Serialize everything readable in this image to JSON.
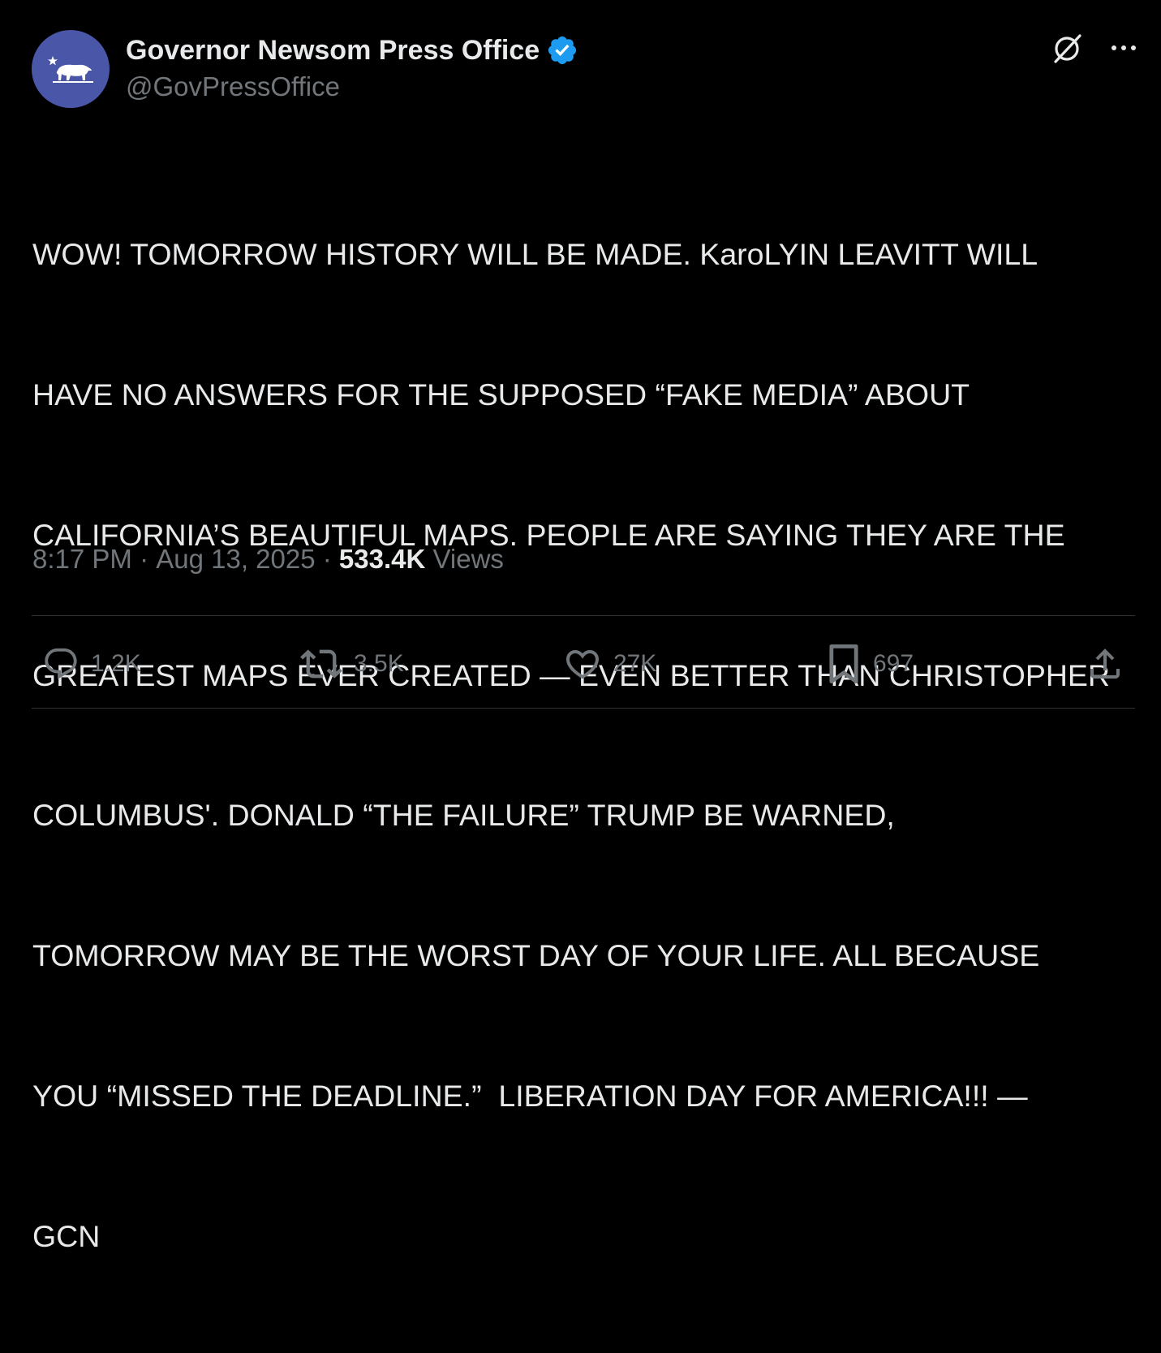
{
  "author": {
    "name": "Governor Newsom Press Office",
    "handle": "@GovPressOffice",
    "verified": true,
    "avatar_icon": "california-bear-icon",
    "avatar_color": "#4a57a8",
    "verified_color": "#1d9bf0"
  },
  "top_actions": {
    "grok_icon": "grok-icon",
    "more_icon": "more-icon"
  },
  "tweet": {
    "lines": [
      "WOW! TOMORROW HISTORY WILL BE MADE. KaroLYIN LEAVITT WILL",
      "HAVE NO ANSWERS FOR THE SUPPOSED “FAKE MEDIA” ABOUT",
      "CALIFORNIA’S BEAUTIFUL MAPS. PEOPLE ARE SAYING THEY ARE THE",
      "GREATEST MAPS EVER CREATED — EVEN BETTER THAN CHRISTOPHER",
      "COLUMBUS'. DONALD “THE FAILURE” TRUMP BE WARNED,",
      "TOMORROW MAY BE THE WORST DAY OF YOUR LIFE. ALL BECAUSE",
      "YOU “MISSED THE DEADLINE.”  LIBERATION DAY FOR AMERICA!!! —",
      "GCN"
    ]
  },
  "meta": {
    "time": "8:17 PM",
    "separator": " · ",
    "date": "Aug 13, 2025",
    "views_count": "533.4K",
    "views_label": " Views"
  },
  "actions": {
    "reply": {
      "icon": "reply-icon",
      "count": "1.2K"
    },
    "repost": {
      "icon": "repost-icon",
      "count": "3.5K"
    },
    "like": {
      "icon": "heart-icon",
      "count": "27K"
    },
    "bookmark": {
      "icon": "bookmark-icon",
      "count": "697"
    },
    "share": {
      "icon": "share-icon"
    }
  },
  "colors": {
    "background": "#000000",
    "text_primary": "#e7e9ea",
    "text_secondary": "#71767b",
    "divider": "#2f3336"
  }
}
